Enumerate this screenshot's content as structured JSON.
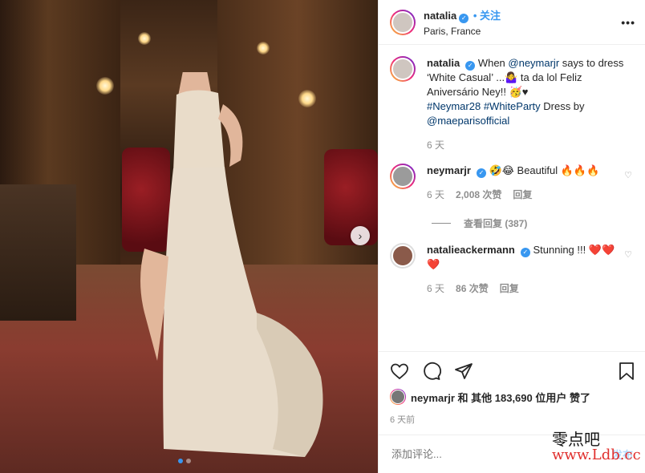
{
  "post": {
    "username": "natalia",
    "follow_label": "• 关注",
    "location": "Paris, France",
    "more_icon": "more-dots-icon"
  },
  "caption": {
    "username": "natalia",
    "line1": "When ",
    "mention1": "@neymarjr",
    "line1b": " says to dress ‘White Casual’ ...",
    "line2": " ta da lol Feliz Aniversário Ney!! ",
    "emoji_a": "🤷‍♀️",
    "emoji_b": "🥳♥",
    "hashtag1": "#Neymar28",
    "hashtag2": "#WhiteParty",
    "dress_by": " Dress by ",
    "mention2": "@maeparisofficial",
    "time": "6 天"
  },
  "comments": [
    {
      "username": "neymarjr",
      "text": "🤣😂 Beautiful 🔥🔥🔥",
      "time": "6 天",
      "likes": "2,008 次赞",
      "reply": "回复",
      "view_replies": "查看回复 (387)"
    },
    {
      "username": "natalieackermann",
      "text": "Stunning !!! ❤️❤️❤️",
      "time": "6 天",
      "likes": "86 次赞",
      "reply": "回复"
    }
  ],
  "likes_line": {
    "user": "neymarjr",
    "rest": " 和 其他 183,690 位用户 赞了"
  },
  "posted_ago": "6 天前",
  "add_comment": {
    "placeholder": "添加评论...",
    "post_label": "发布"
  },
  "watermark": {
    "line1": "零点吧",
    "line2": "www.Ldb.cc"
  },
  "colors": {
    "accent": "#3897f0",
    "text": "#262626",
    "muted": "#8e8e8e"
  }
}
